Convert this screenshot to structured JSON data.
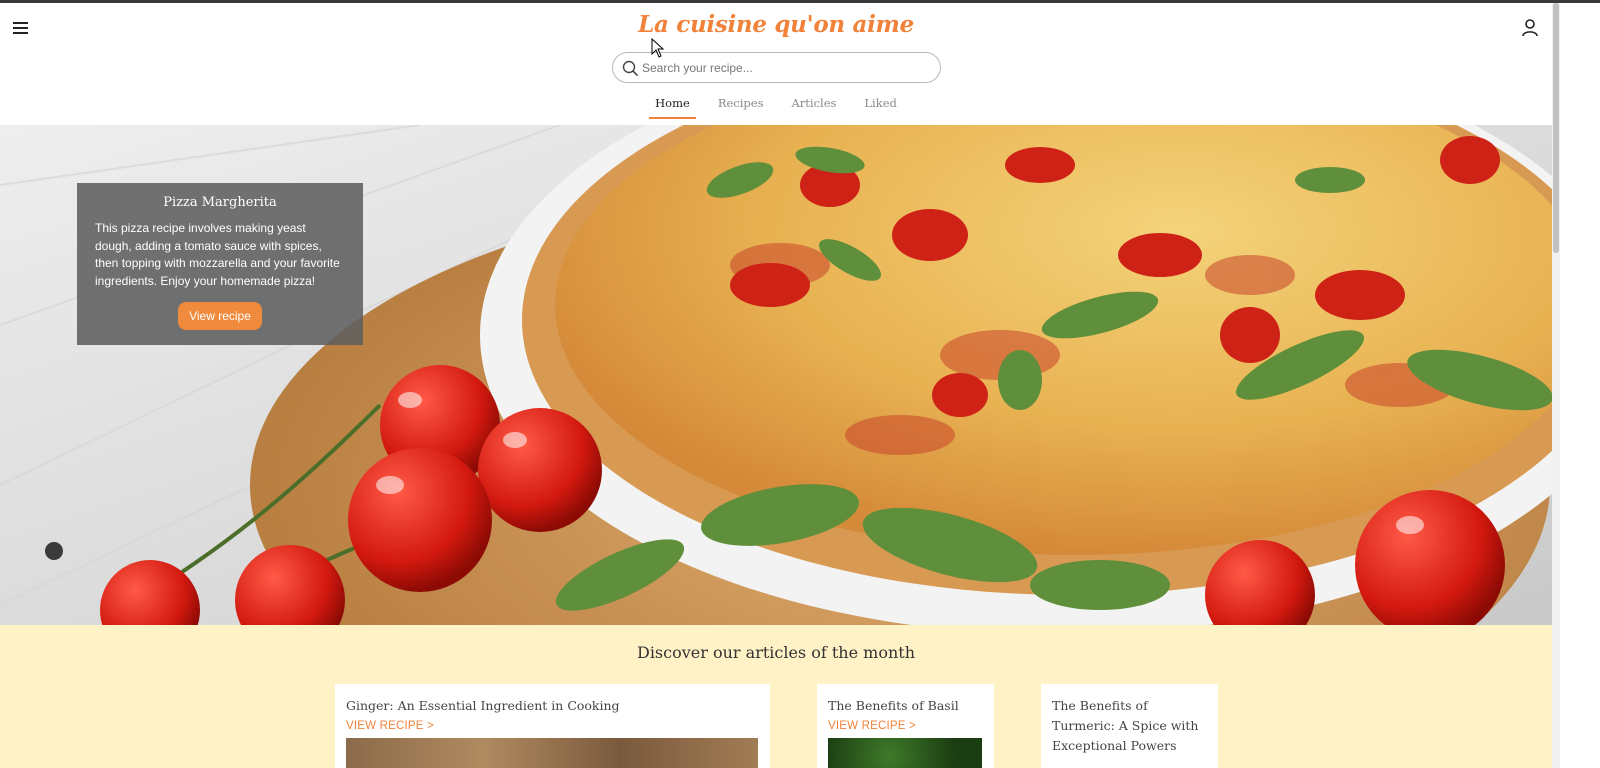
{
  "header": {
    "brand": "La cuisine qu'on aime",
    "menu_icon": "hamburger-menu-icon",
    "user_icon": "user-icon"
  },
  "search": {
    "placeholder": "Search your recipe...",
    "value": ""
  },
  "nav": {
    "tabs": [
      {
        "label": "Home",
        "active": true
      },
      {
        "label": "Recipes",
        "active": false
      },
      {
        "label": "Articles",
        "active": false
      },
      {
        "label": "Liked",
        "active": false
      }
    ]
  },
  "hero": {
    "title": "Pizza Margherita",
    "description": "This pizza recipe involves making yeast dough, adding a tomato sauce with spices, then topping with mozzarella and your favorite ingredients. Enjoy your homemade pizza!",
    "button_label": "View recipe"
  },
  "articles": {
    "heading": "Discover our articles of the month",
    "items": [
      {
        "title": "Ginger: An Essential Ingredient in Cooking",
        "link": "VIEW RECIPE >"
      },
      {
        "title": "The Benefits of Basil",
        "link": "VIEW RECIPE >"
      },
      {
        "title": "The Benefits of Turmeric: A Spice with Exceptional Powers",
        "link": ""
      }
    ]
  },
  "colors": {
    "accent": "#f0823a",
    "articles_bg": "#fff2c6",
    "card_overlay": "#5f5f5f"
  }
}
